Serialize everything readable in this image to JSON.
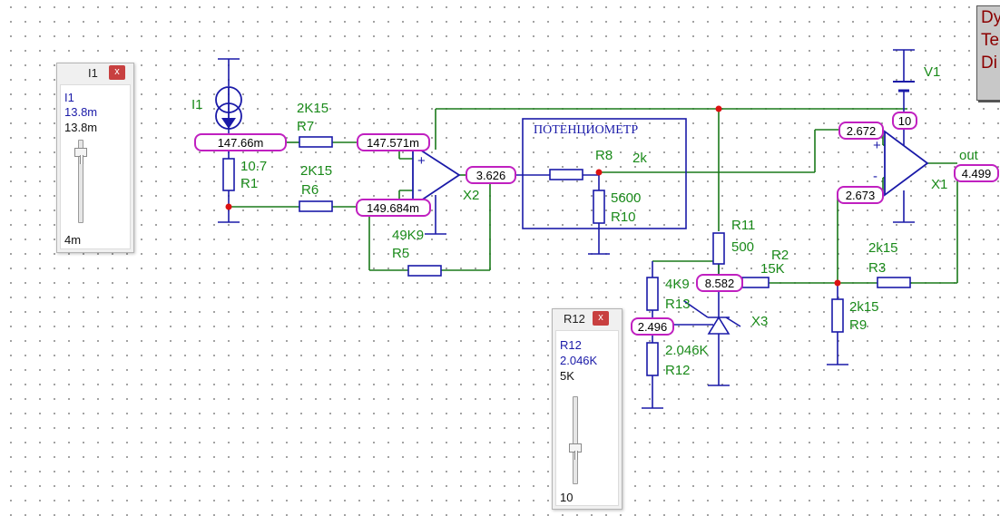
{
  "schematic": {
    "probes": {
      "i1_node": "147.66m",
      "r7_right": "147.571m",
      "r6_right": "149.684m",
      "x2_out": "3.626",
      "v1_node": "10",
      "x1_plus": "2.672",
      "x1_minus": "2.673",
      "x1_out": "4.499",
      "r11_node": "8.582",
      "r13_node": "2.496"
    },
    "labels": {
      "i1": "I1",
      "r1_value": "10.7",
      "r1_name": "R1",
      "r7_value": "2K15",
      "r7_name": "R7",
      "r6_value": "2K15",
      "r6_name": "R6",
      "r5_value": "49K9",
      "r5_name": "R5",
      "x2_name": "X2",
      "pot_title": "ПОТЕНЦИОМЕТР",
      "r8_name": "R8",
      "r8_value": "2k",
      "r10_value": "5600",
      "r10_name": "R10",
      "r11_name": "R11",
      "r11_value": "500",
      "r2_name": "R2",
      "r2_value": "15K",
      "r13_value": "4K9",
      "r13_name": "R13",
      "r12_value": "2.046K",
      "r12_name": "R12",
      "x3_name": "X3",
      "r3_value": "2k15",
      "r3_name": "R3",
      "r9_value": "2k15",
      "r9_name": "R9",
      "v1_name": "V1",
      "x1_name": "X1",
      "out_label": "out",
      "plus_sign": "+",
      "minus_sign": "-"
    }
  },
  "slider_i1": {
    "title": "I1",
    "close": "x",
    "name": "I1",
    "value": "13.8m",
    "max": "13.8m",
    "min": "4m",
    "level": 1.0
  },
  "slider_r12": {
    "title": "R12",
    "close": "x",
    "name": "R12",
    "value": "2.046K",
    "max": "5K",
    "min": "10",
    "level": 0.41
  },
  "info_panel": {
    "line1": "Dy",
    "line2": "Te",
    "line3": "Di"
  }
}
